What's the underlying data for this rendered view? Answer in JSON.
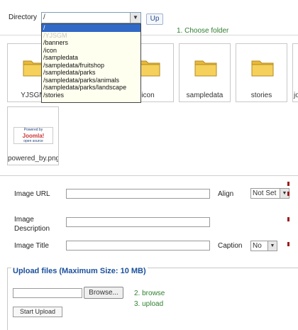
{
  "directory": {
    "label": "Directory",
    "selected": "/",
    "up_label": "Up",
    "hint": "1. Choose folder",
    "options": [
      "/",
      "/YJSGM",
      "/banners",
      "/icon",
      "/sampledata",
      "/sampledata/fruitshop",
      "/sampledata/parks",
      "/sampledata/parks/animals",
      "/sampledata/parks/landscape",
      "/stories"
    ]
  },
  "thumbnails": [
    {
      "name": "YJSGM",
      "icon": "folder-icon"
    },
    {
      "name": "icon",
      "icon": "folder-icon"
    },
    {
      "name": "sampledata",
      "icon": "folder-icon"
    },
    {
      "name": "stories",
      "icon": "folder-icon"
    },
    {
      "name": "jo",
      "icon": "folder-icon"
    },
    {
      "name": "powered_by.png",
      "icon": "image-thumbnail"
    }
  ],
  "thumbnail_image_text": {
    "line1": "Powered by",
    "line2": "Joomla!",
    "line3": "open source"
  },
  "form": {
    "image_url_label": "Image URL",
    "align_label": "Align",
    "align_value": "Not Set",
    "image_description_label": "Image Description",
    "image_title_label": "Image Title",
    "caption_label": "Caption",
    "caption_value": "No"
  },
  "upload": {
    "legend": "Upload files (Maximum Size: 10 MB)",
    "browse_label": "Browse...",
    "start_label": "Start Upload",
    "hint_browse": "2. browse",
    "hint_upload": "3. upload"
  },
  "colors": {
    "hint_green": "#2f7f2f",
    "legend_blue": "#1a4f9c",
    "selection_blue": "#3169c6"
  }
}
